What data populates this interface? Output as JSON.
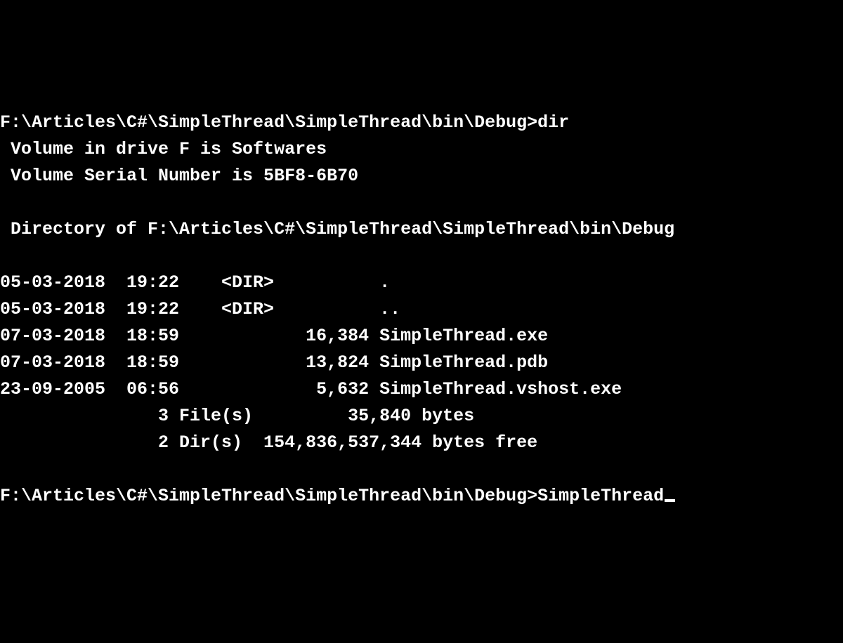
{
  "prompt1": {
    "path": "F:\\Articles\\C#\\SimpleThread\\SimpleThread\\bin\\Debug>",
    "command": "dir"
  },
  "volume_label": " Volume in drive F is Softwares",
  "volume_serial": " Volume Serial Number is 5BF8-6B70",
  "directory_of": " Directory of F:\\Articles\\C#\\SimpleThread\\SimpleThread\\bin\\Debug",
  "entries": [
    "05-03-2018  19:22    <DIR>          .",
    "05-03-2018  19:22    <DIR>          ..",
    "07-03-2018  18:59            16,384 SimpleThread.exe",
    "07-03-2018  18:59            13,824 SimpleThread.pdb",
    "23-09-2005  06:56             5,632 SimpleThread.vshost.exe"
  ],
  "summary_files": "               3 File(s)         35,840 bytes",
  "summary_dirs": "               2 Dir(s)  154,836,537,344 bytes free",
  "prompt2": {
    "path": "F:\\Articles\\C#\\SimpleThread\\SimpleThread\\bin\\Debug>",
    "command": "SimpleThread"
  }
}
